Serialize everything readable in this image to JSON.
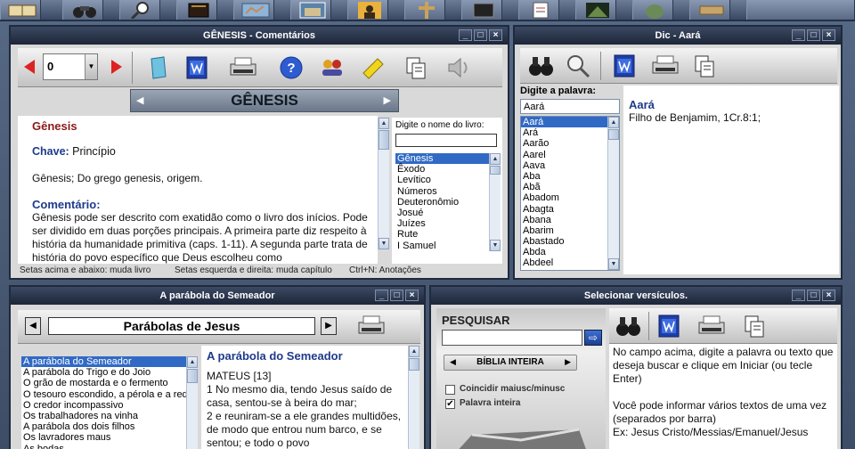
{
  "toolbar": {
    "icons": [
      "book-icon",
      "binoculars-icon",
      "magnifier-icon",
      "bible-icon",
      "map-icon",
      "photo-icon",
      "person-icon",
      "cross-icon",
      "dictionary-icon",
      "notes-icon",
      "painting-icon",
      "pot-icon",
      "scroll-icon"
    ]
  },
  "win1": {
    "title": "GÊNESIS - Comentários",
    "chapter_value": "0",
    "book_banner": "GÊNESIS",
    "content": {
      "h1": "Gênesis",
      "chave_label": "Chave:",
      "chave_value": " Princípio",
      "p1": "Gênesis; Do grego genesis, origem.",
      "h2": "Comentário:",
      "p2": "Gênesis pode ser descrito com exatidão como o livro dos inícios. Pode ser dividido em duas porções principais. A primeira parte diz respeito à história da humanidade primitiva (caps. 1-11). A segunda parte trata de história do povo específico que Deus escolheu como"
    },
    "book_prompt": "Digite o nome do livro:",
    "books": [
      "Gênesis",
      "Êxodo",
      "Levítico",
      "Números",
      "Deuteronômio",
      "Josué",
      "Juízes",
      "Rute",
      "I Samuel"
    ],
    "status": [
      "Setas acima e abaixo: muda livro",
      "Setas esquerda e direita: muda capítulo",
      "Ctrl+N: Anotações"
    ]
  },
  "win2": {
    "title": "Dic - Aará",
    "prompt": "Digite a palavra:",
    "input_value": "Aará",
    "words": [
      "Aará",
      "Ará",
      "Aarão",
      "Aarel",
      "Aava",
      "Aba",
      "Abã",
      "Abadom",
      "Abagta",
      "Abana",
      "Abarim",
      "Abastado",
      "Abda",
      "Abdeel"
    ],
    "entry_title": "Aará",
    "entry_text": "Filho de Benjamim, 1Cr.8:1;"
  },
  "win3": {
    "title": "A parábola do Semeador",
    "selector": "Parábolas de Jesus",
    "items": [
      "A parábola do Semeador",
      "A parábola do Trigo e do Joio",
      "O grão de mostarda e o fermento",
      "O tesouro escondido, a pérola e a rede",
      "O credor incompassivo",
      "Os trabalhadores na vinha",
      "A parábola dos dois filhos",
      "Os lavradores maus",
      "As bodas"
    ],
    "heading": "A parábola do Semeador",
    "ref": "MATEUS [13]",
    "v1": "1 No mesmo dia, tendo Jesus saído de casa, sentou-se à beira do mar;",
    "v2": "2 e reuniram-se a ele grandes multidões, de modo que entrou num barco, e se sentou; e todo o povo"
  },
  "win4": {
    "title": "Selecionar versículos.",
    "search_label": "PESQUISAR",
    "scope": "BÍBLIA INTEIRA",
    "opt1": "Coincidir maiusc/minusc",
    "opt2": "Palavra inteira",
    "help1": "No campo acima, digite a palavra ou texto que deseja buscar e clique em Iniciar (ou tecle Enter)",
    "help2": "Você pode informar vários textos de uma vez (separados por barra)",
    "help3": "Ex: Jesus Cristo/Messias/Emanuel/Jesus"
  }
}
